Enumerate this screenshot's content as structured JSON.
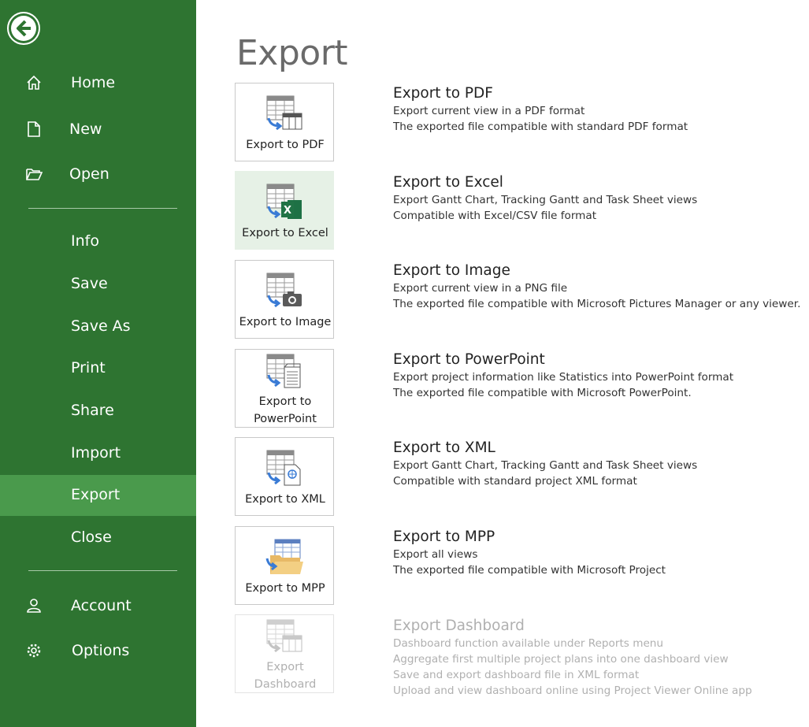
{
  "sidebar": {
    "back_label": "Back",
    "items": [
      {
        "label": "Home"
      },
      {
        "label": "New"
      },
      {
        "label": "Open"
      },
      {
        "label": "Info"
      },
      {
        "label": "Save"
      },
      {
        "label": "Save As"
      },
      {
        "label": "Print"
      },
      {
        "label": "Share"
      },
      {
        "label": "Import"
      },
      {
        "label": "Export"
      },
      {
        "label": "Close"
      },
      {
        "label": "Account"
      },
      {
        "label": "Options"
      }
    ],
    "active": "Export"
  },
  "main": {
    "title": "Export",
    "options": [
      {
        "tile_label": "Export to PDF",
        "tile_label_b": "",
        "heading": "Export to PDF",
        "lines": [
          "Export current view in a PDF format",
          "The exported file compatible with standard PDF format"
        ]
      },
      {
        "tile_label": "Export to Excel",
        "tile_label_b": "",
        "heading": "Export to Excel",
        "lines": [
          "Export Gantt Chart, Tracking Gantt and Task Sheet views",
          "Compatible with Excel/CSV file format"
        ]
      },
      {
        "tile_label": "Export to Image",
        "tile_label_b": "",
        "heading": "Export to Image",
        "lines": [
          "Export current view in a PNG file",
          "The exported file compatible with Microsoft Pictures Manager or any viewer."
        ]
      },
      {
        "tile_label": "Export to",
        "tile_label_b": "PowerPoint",
        "heading": "Export to PowerPoint",
        "lines": [
          "Export project information like Statistics into PowerPoint format",
          "The exported file compatible with Microsoft PowerPoint."
        ]
      },
      {
        "tile_label": "Export to XML",
        "tile_label_b": "",
        "heading": "Export to XML",
        "lines": [
          "Export Gantt Chart, Tracking Gantt and Task Sheet views",
          "Compatible with standard project XML format"
        ]
      },
      {
        "tile_label": "Export to MPP",
        "tile_label_b": "",
        "heading": "Export to MPP",
        "lines": [
          "Export all views",
          "The exported file compatible with Microsoft Project"
        ]
      },
      {
        "tile_label": "Export",
        "tile_label_b": "Dashboard",
        "heading": "Export Dashboard",
        "lines": [
          "Dashboard function available under Reports menu",
          "Aggregate first multiple project plans into one dashboard view",
          "Save and export dashboard file in XML format",
          "Upload and view dashboard online using Project Viewer Online app"
        ]
      }
    ]
  },
  "colors": {
    "sidebar": "#2e7431",
    "sidebar_active": "#4a9a4c",
    "highlight": "#e6f1e6",
    "disabled_text": "#b0b0b0"
  },
  "icons": [
    "back-arrow-icon",
    "home-icon",
    "new-document-icon",
    "open-folder-icon",
    "account-icon",
    "options-gear-icon",
    "pdf-export-icon",
    "excel-export-icon",
    "image-export-icon",
    "powerpoint-export-icon",
    "xml-export-icon",
    "mpp-export-icon",
    "dashboard-export-icon"
  ]
}
